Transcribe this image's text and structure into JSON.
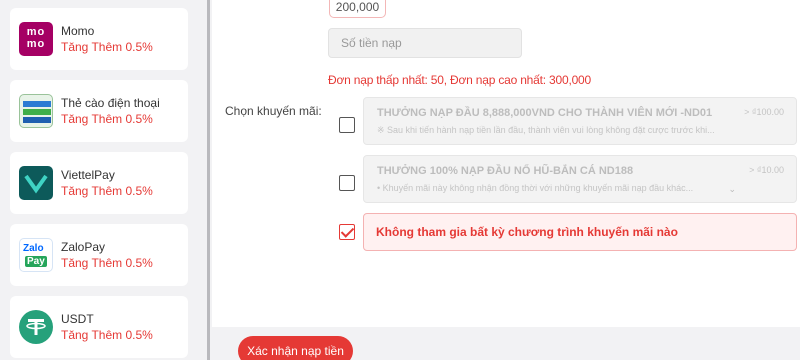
{
  "payment_methods": [
    {
      "name": "Momo",
      "bonus": "Tăng Thêm 0.5%",
      "icon": "momo-logo-icon",
      "logo_text": "mo mo"
    },
    {
      "name": "Thẻ cào điện thoại",
      "bonus": "Tăng Thêm 0.5%",
      "icon": "phone-card-icon"
    },
    {
      "name": "ViettelPay",
      "bonus": "Tăng Thêm 0.5%",
      "icon": "viettelpay-logo-icon"
    },
    {
      "name": "ZaloPay",
      "bonus": "Tăng Thêm 0.5%",
      "icon": "zalopay-logo-icon",
      "logo_text_top": "Zalo",
      "logo_text_bottom": "Pay"
    },
    {
      "name": "USDT",
      "bonus": "Tăng Thêm 0.5%",
      "icon": "usdt-logo-icon"
    }
  ],
  "deposit": {
    "selected_amount": "200,000",
    "amount_placeholder": "Số tiền nạp",
    "limits_text": "Đơn nạp thấp nhất:  50,  Đơn nạp cao nhất:  300,000"
  },
  "promotions": {
    "label": "Chọn khuyến mãi:",
    "items": [
      {
        "title": "THƯỞNG NẠP ĐẦU 8,888,000VND CHO THÀNH VIÊN MỚI -ND01",
        "desc": "※ Sau khi tiến hành nạp tiền lần đầu, thành viên vui lòng không đặt cược trước khi...",
        "amount": "> ₫100.00",
        "checked": false
      },
      {
        "title": "THƯỞNG 100% NẠP ĐẦU NỔ HŨ-BẮN CÁ ND188",
        "desc": "• Khuyến mãi này không nhận đồng thời với những khuyến mãi nạp đầu khác...",
        "amount": "> ₫10.00",
        "checked": false
      }
    ],
    "none_option": {
      "label": "Không tham gia bất kỳ chương trình khuyến mãi nào",
      "checked": true
    }
  },
  "confirm_label": "Xác nhận nạp tiền",
  "colors": {
    "accent": "#e53935",
    "momo": "#a50064",
    "usdt": "#26a17b",
    "zalopay": "#0068ff",
    "viettel": "#0d5a5a"
  }
}
